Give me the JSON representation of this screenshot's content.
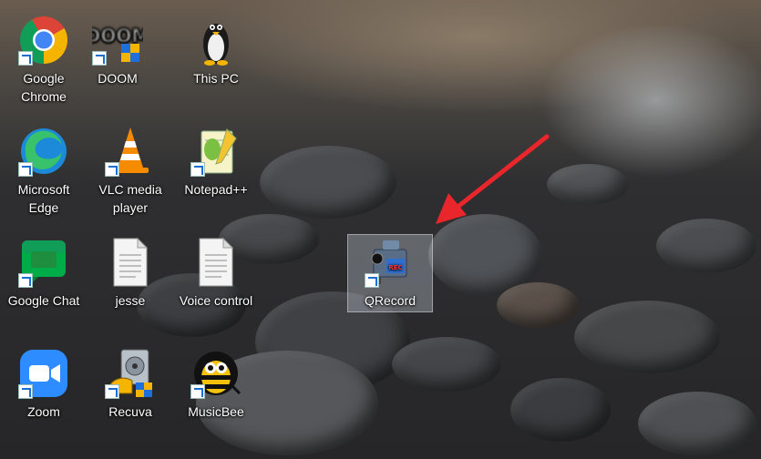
{
  "desktop": {
    "icons": [
      {
        "label": "Google Chrome",
        "icon": "chrome-icon",
        "shortcut": true
      },
      {
        "label": "DOOM",
        "icon": "doom-icon",
        "shortcut": true
      },
      {
        "label": "This PC",
        "icon": "tux-penguin-icon",
        "shortcut": false
      },
      {
        "label": "Microsoft Edge",
        "icon": "edge-icon",
        "shortcut": true
      },
      {
        "label": "VLC media player",
        "icon": "vlc-cone-icon",
        "shortcut": true
      },
      {
        "label": "Notepad++",
        "icon": "notepadpp-icon",
        "shortcut": true
      },
      {
        "label": "Google Chat",
        "icon": "google-chat-icon",
        "shortcut": true
      },
      {
        "label": "jesse",
        "icon": "document-icon",
        "shortcut": false
      },
      {
        "label": "Voice control",
        "icon": "document-icon",
        "shortcut": false
      },
      {
        "label": "QRecord",
        "icon": "camcorder-icon",
        "shortcut": true,
        "selected": true
      },
      {
        "label": "Zoom",
        "icon": "zoom-camera-icon",
        "shortcut": true
      },
      {
        "label": "Recuva",
        "icon": "recuva-icon",
        "shortcut": true
      },
      {
        "label": "MusicBee",
        "icon": "musicbee-icon",
        "shortcut": true
      }
    ],
    "annotation": {
      "color": "#e8262b",
      "points_to": "QRecord"
    }
  }
}
